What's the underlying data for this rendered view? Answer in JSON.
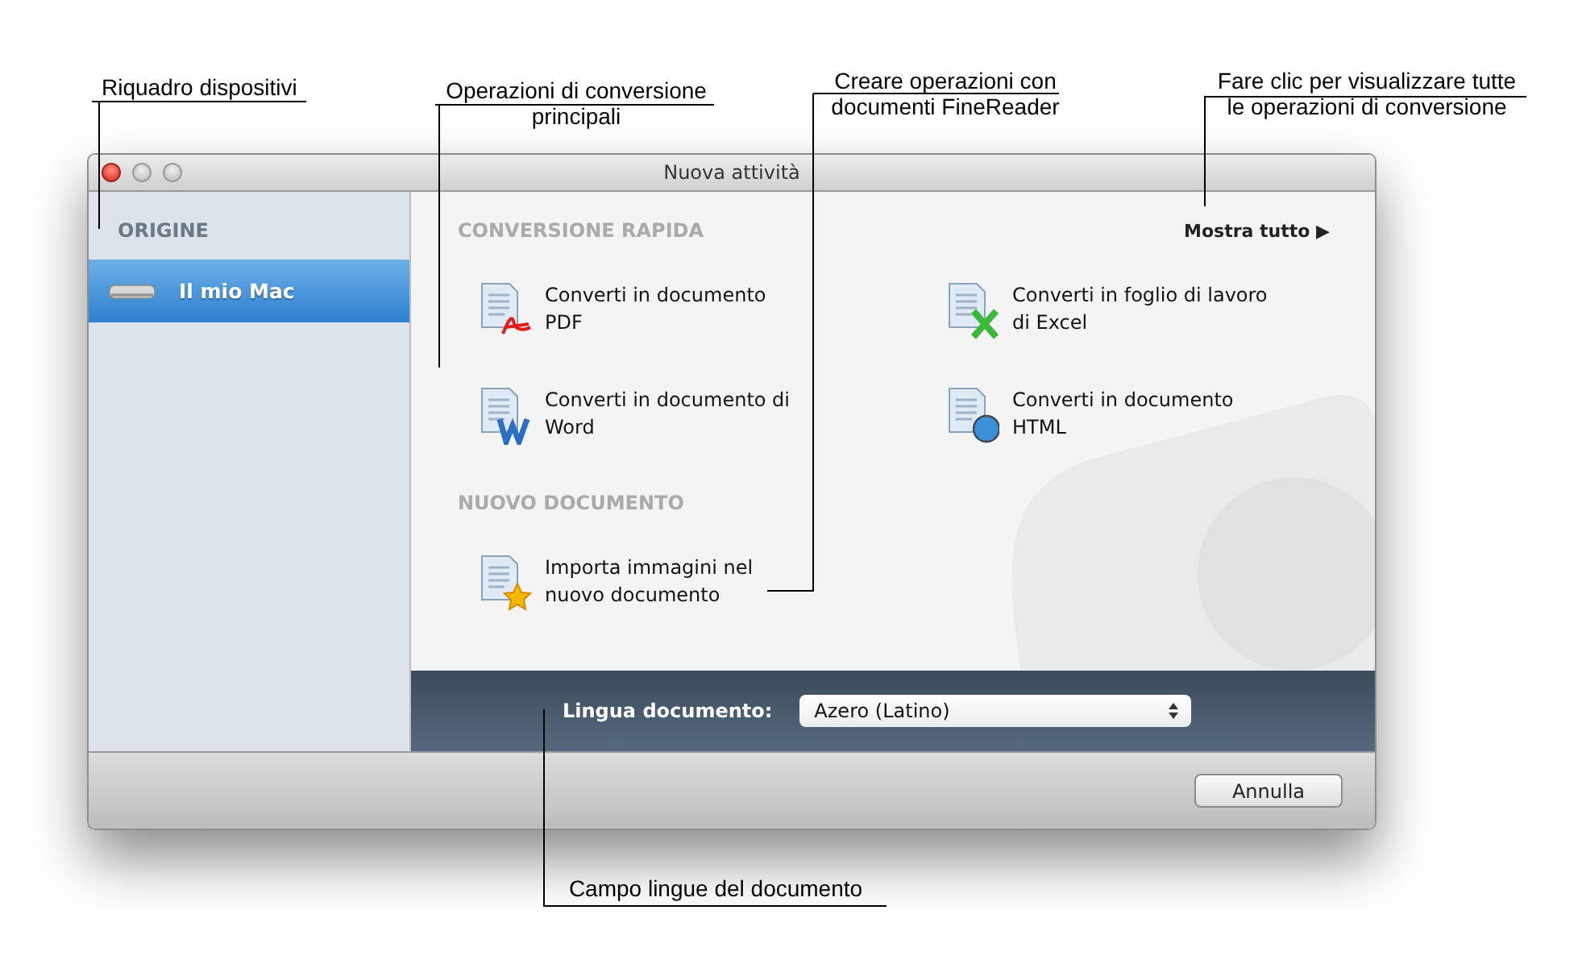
{
  "window": {
    "title": "Nuova attività"
  },
  "sidebar": {
    "header": "ORIGINE",
    "items": [
      {
        "label": "Il mio Mac",
        "selected": true
      }
    ]
  },
  "sections": [
    {
      "title": "CONVERSIONE RAPIDA",
      "show_all": "Mostra tutto ▶",
      "items": [
        {
          "kind": "pdf",
          "label": "Converti in documento\nPDF"
        },
        {
          "kind": "excel",
          "label": "Converti in foglio di lavoro\ndi Excel"
        },
        {
          "kind": "word",
          "label": "Converti in documento di\nWord"
        },
        {
          "kind": "html",
          "label": "Converti in documento\nHTML"
        }
      ]
    },
    {
      "title": "NUOVO DOCUMENTO",
      "items": [
        {
          "kind": "import",
          "label": "Importa immagini nel\nnuovo documento"
        }
      ]
    }
  ],
  "language_bar": {
    "label": "Lingua documento:",
    "value": "Azero (Latino)"
  },
  "buttons": [
    "Annulla"
  ],
  "callouts": [
    {
      "text": "Riquadro dispositivi"
    },
    {
      "text": "Operazioni di conversione\nprincipali"
    },
    {
      "text": "Creare operazioni con\ndocumenti FineReader"
    },
    {
      "text": "Fare clic per visualizzare tutte\nle operazioni di conversione"
    },
    {
      "text": "Campo lingue del documento"
    }
  ]
}
